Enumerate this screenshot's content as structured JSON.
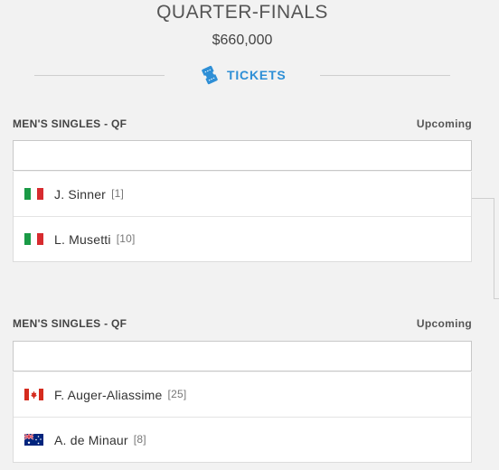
{
  "round": {
    "title": "QUARTER-FINALS",
    "prize": "$660,000"
  },
  "tickets": {
    "label": "TICKETS",
    "icon": "ticket-icon",
    "color": "#2e8fd6"
  },
  "matches": [
    {
      "event": "MEN'S SINGLES - QF",
      "status": "Upcoming",
      "players": [
        {
          "name": "J. Sinner",
          "seed": "[1]",
          "country_flag": "italy-flag-icon"
        },
        {
          "name": "L. Musetti",
          "seed": "[10]",
          "country_flag": "italy-flag-icon"
        }
      ]
    },
    {
      "event": "MEN'S SINGLES - QF",
      "status": "Upcoming",
      "players": [
        {
          "name": "F. Auger-Aliassime",
          "seed": "[25]",
          "country_flag": "canada-flag-icon"
        },
        {
          "name": "A. de Minaur",
          "seed": "[8]",
          "country_flag": "australia-flag-icon"
        }
      ]
    }
  ]
}
